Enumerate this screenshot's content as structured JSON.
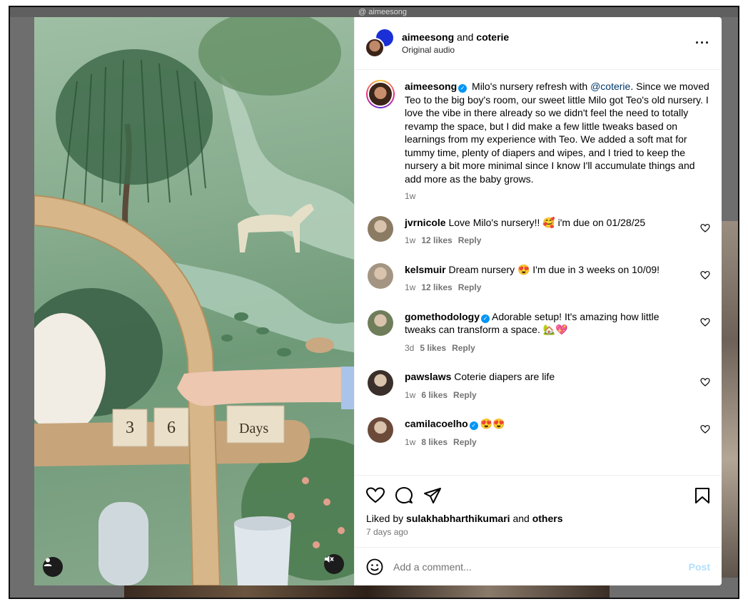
{
  "backdrop": {
    "handle": "@ aimeesong"
  },
  "header": {
    "user1": "aimeesong",
    "joiner": "and",
    "user2": "coterie",
    "audio": "Original audio",
    "more_icon": "more-horizontal-icon"
  },
  "caption": {
    "username": "aimeesong",
    "text_before": "Milo's nursery refresh with ",
    "mention": "@coterie",
    "text_after": ". Since we moved Teo to the big boy's room, our sweet little Milo got Teo's old nursery. I love the vibe in there already so we didn't feel the need to totally revamp the space, but I did make a few little tweaks based on learnings from my experience with Teo. We added a soft mat for tummy time, plenty of diapers and wipes, and I tried to keep the nursery a bit more minimal since I know I'll accumulate things and add more as the baby grows.",
    "time": "1w"
  },
  "comments": [
    {
      "username": "jvrnicole",
      "verified": false,
      "text": "Love Milo's nursery!! 🥰 i'm due on 01/28/25",
      "time": "1w",
      "likes": "12 likes",
      "reply": "Reply",
      "avatar_color": "#8b7b63"
    },
    {
      "username": "kelsmuir",
      "verified": false,
      "text": "Dream nursery 😍 I'm due in 3 weeks on 10/09!",
      "time": "1w",
      "likes": "12 likes",
      "reply": "Reply",
      "avatar_color": "#a49583"
    },
    {
      "username": "gomethodology",
      "verified": true,
      "text": "Adorable setup! It's amazing how little tweaks can transform a space. 🏡💖",
      "time": "3d",
      "likes": "5 likes",
      "reply": "Reply",
      "avatar_color": "#6f7d5a"
    },
    {
      "username": "pawslaws",
      "verified": false,
      "text": "Coterie diapers are life",
      "time": "1w",
      "likes": "6 likes",
      "reply": "Reply",
      "avatar_color": "#3a2f2a"
    },
    {
      "username": "camilacoelho",
      "verified": true,
      "text": "😍😍",
      "time": "1w",
      "likes": "8 likes",
      "reply": "Reply",
      "avatar_color": "#6b4a3a"
    }
  ],
  "actions": {
    "liked_prefix": "Liked by",
    "liked_user": "sulakhabharthikumari",
    "liked_joiner": "and",
    "liked_others": "others",
    "date": "7 days ago"
  },
  "composer": {
    "placeholder": "Add a comment...",
    "post_label": "Post"
  },
  "media": {
    "block_1": "3",
    "block_2": "6",
    "block_3": "Days"
  },
  "colors": {
    "link": "#00376b",
    "verified": "#0095f6",
    "muted": "#737373",
    "post_disabled": "#b2dffc"
  }
}
